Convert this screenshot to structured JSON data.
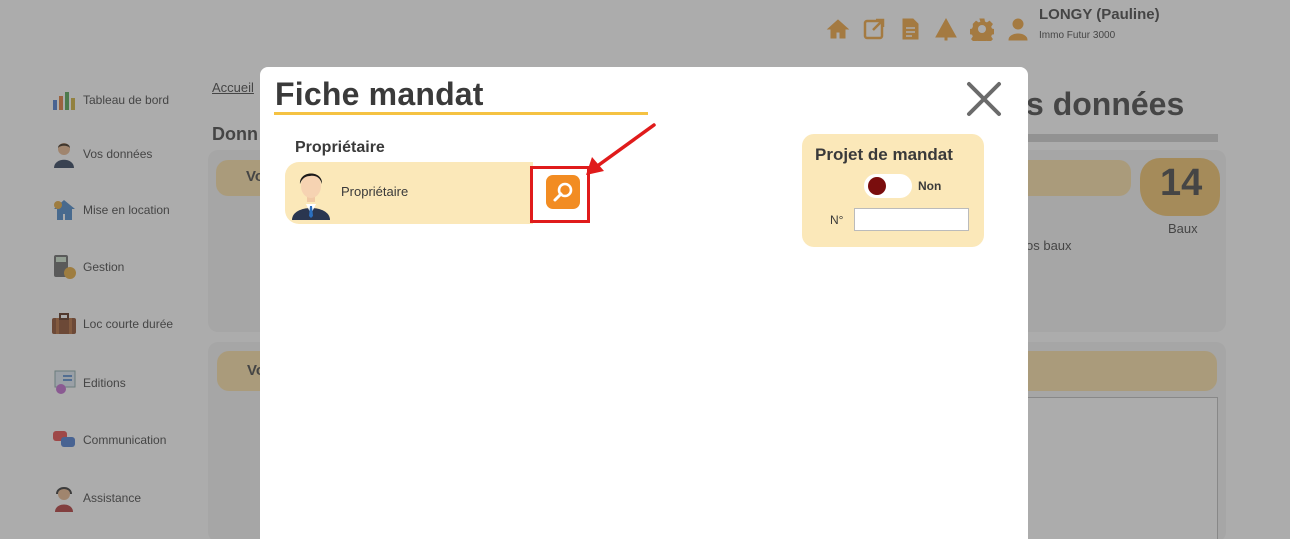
{
  "header": {
    "icons": [
      "home-icon",
      "external-link-icon",
      "document-icon",
      "tree-icon",
      "gear-icon",
      "user-icon"
    ],
    "user_name": "LONGY (Pauline)",
    "user_company": "Immo Futur 3000"
  },
  "sidebar": {
    "items": [
      {
        "label": "Tableau de bord",
        "icon": "dashboard-icon"
      },
      {
        "label": "Vos données",
        "icon": "person-icon"
      },
      {
        "label": "Mise en location",
        "icon": "keys-house-icon"
      },
      {
        "label": "Gestion",
        "icon": "calculator-icon"
      },
      {
        "label": "Loc courte durée",
        "icon": "suitcase-icon"
      },
      {
        "label": "Editions",
        "icon": "editions-icon"
      },
      {
        "label": "Communication",
        "icon": "chat-icon"
      },
      {
        "label": "Assistance",
        "icon": "support-icon"
      }
    ]
  },
  "background": {
    "breadcrumb": "Accueil",
    "left_heading": "Donn",
    "right_heading": "s données",
    "band1_label": "Vo",
    "band2_label": "Vo",
    "count": "14",
    "count_label": "Baux",
    "vos_baux": "os baux"
  },
  "modal": {
    "title": "Fiche mandat",
    "owner_section_label": "Propriétaire",
    "owner_name": "Propriétaire",
    "projet": {
      "title": "Projet de mandat",
      "toggle_label": "Non",
      "number_label": "N°",
      "number_value": ""
    }
  },
  "colors": {
    "accent_orange": "#f28c22",
    "card_yellow": "#fbe8b9",
    "underline_yellow": "#f5c242",
    "highlight_red": "#e01b1b",
    "toggle_knob": "#7a0d0d"
  }
}
